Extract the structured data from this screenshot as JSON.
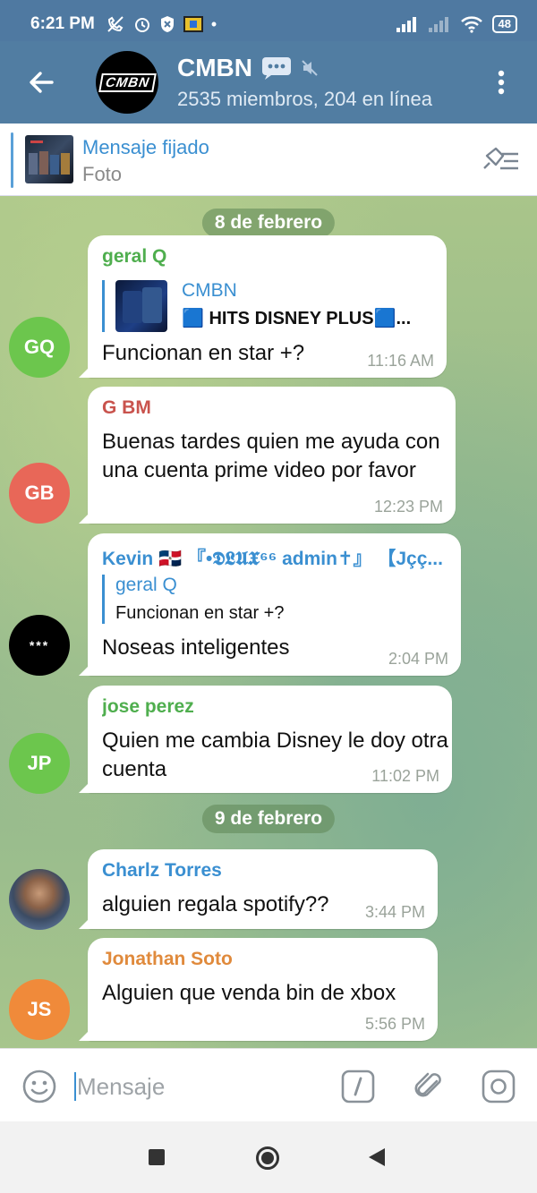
{
  "status_bar": {
    "time": "6:21 PM",
    "battery": "48"
  },
  "header": {
    "title": "CMBN",
    "subtitle": "2535 miembros, 204 en línea",
    "avatar_text": "CMBN"
  },
  "pinned": {
    "title": "Mensaje fijado",
    "subtitle": "Foto"
  },
  "dates": [
    "8 de febrero",
    "9 de febrero"
  ],
  "messages": [
    {
      "sender": "geral Q",
      "sender_color": "#4fae4e",
      "reply_name": "CMBN",
      "reply_text": "🟦 HITS DISNEY PLUS🟦...",
      "text": "Funcionan en star +?",
      "time": "11:16 AM",
      "avatar_initials": "GQ",
      "avatar_color": "#6cc64d"
    },
    {
      "sender": "G BM",
      "sender_color": "#c9534d",
      "text": "Buenas tardes quien me ayuda con una cuenta prime video por favor",
      "time": "12:23 PM",
      "avatar_initials": "GB",
      "avatar_color": "#e86758"
    },
    {
      "sender": "Kevin 🇩🇴 『•𝕯𝕷𝖀𝖃⁶⁶ admin✝』 【Jçç...",
      "sender_color": "#3a8fd1",
      "reply_name": "geral Q",
      "reply_text": "Funcionan en star +?",
      "text": "Noseas inteligentes",
      "time": "2:04 PM",
      "avatar_initials": "***",
      "avatar_color": "#000000"
    },
    {
      "sender": "jose perez",
      "sender_color": "#4fae4e",
      "text": "Quien me cambia Disney le doy otra cuenta",
      "time": "11:02 PM",
      "avatar_initials": "JP",
      "avatar_color": "#6cc64d"
    },
    {
      "sender": "Charlz Torres",
      "sender_color": "#3a8fd1",
      "text": "alguien regala spotify??",
      "time": "3:44 PM",
      "avatar_initials": "",
      "avatar_color": "#5a6b80"
    },
    {
      "sender": "Jonathan Soto",
      "sender_color": "#e08a3c",
      "text": "Alguien que venda bin de xbox",
      "time": "5:56 PM",
      "avatar_initials": "JS",
      "avatar_color": "#f08a3a"
    }
  ],
  "input": {
    "placeholder": "Mensaje"
  },
  "icons": {
    "back": "back-arrow-icon",
    "menu": "kebab-menu-icon",
    "pinned_list": "pinned-list-icon",
    "emoji": "emoji-icon",
    "command": "slash-command-icon",
    "attach": "paperclip-icon",
    "camera": "camera-icon"
  }
}
